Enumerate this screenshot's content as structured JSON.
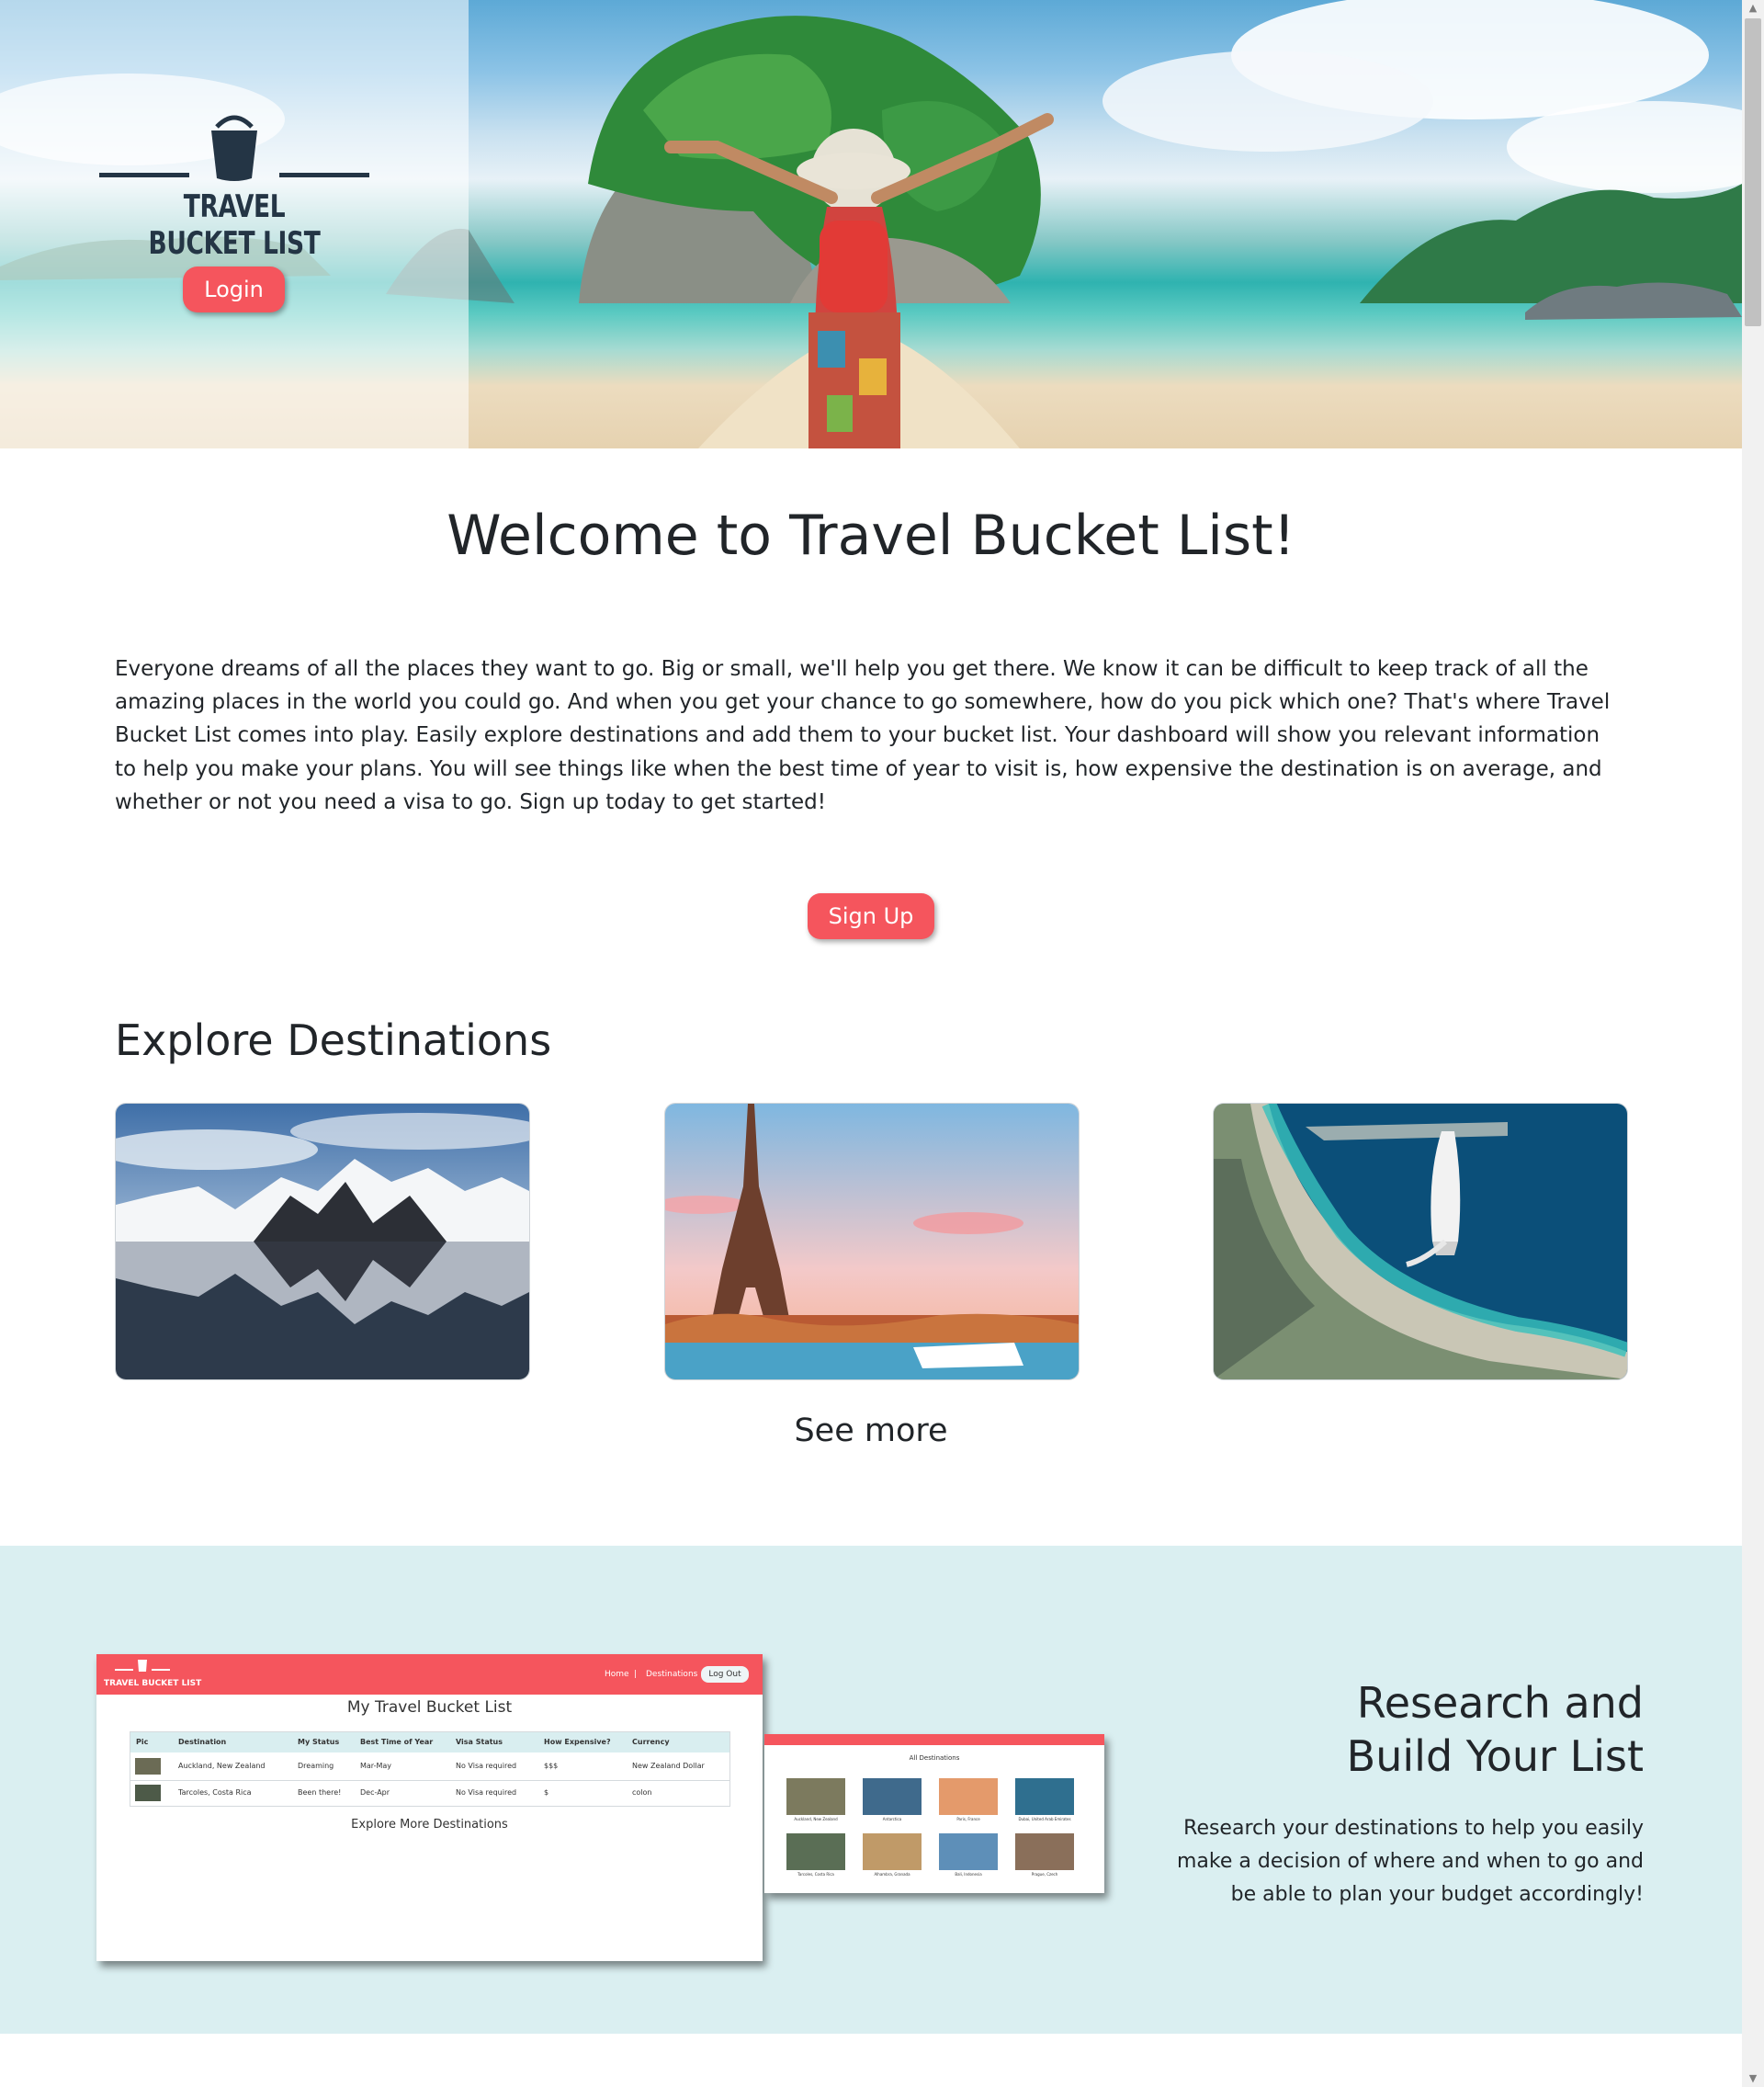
{
  "brand": {
    "logo_text": "TRAVEL BUCKET LIST"
  },
  "header": {
    "login_label": "Login"
  },
  "welcome": {
    "title": "Welcome to Travel Bucket List!",
    "intro": "Everyone dreams of all the places they want to go. Big or small, we'll help you get there. We know it can be difficult to keep track of all the amazing places in the world you could go. And when you get your chance to go somewhere, how do you pick which one? That's where Travel Bucket List comes into play. Easily explore destinations and add them to your bucket list. Your dashboard will show you relevant information to help you make your plans. You will see things like when the best time of year to visit is, how expensive the destination is on average, and whether or not you need a visa to go. Sign up today to get started!",
    "signup_label": "Sign Up"
  },
  "explore": {
    "title": "Explore Destinations",
    "cards": [
      {
        "icon": "snowy-mountains-photo"
      },
      {
        "icon": "eiffel-tower-photo"
      },
      {
        "icon": "burj-al-arab-photo"
      }
    ],
    "see_more": "See more"
  },
  "research": {
    "title": "Research and Build Your List",
    "text": "Research your destinations to help you easily make a decision of where and when to go and be able to plan your budget accordingly!",
    "dashboard_preview": {
      "logo_text": "TRAVEL BUCKET LIST",
      "nav_home": "Home",
      "nav_sep": "|",
      "nav_destinations": "Destinations",
      "logout": "Log Out",
      "title": "My Travel Bucket List",
      "columns": [
        "Pic",
        "Destination",
        "My Status",
        "Best Time of Year",
        "Visa Status",
        "How Expensive?",
        "Currency"
      ],
      "rows": [
        [
          "",
          "Auckland, New Zealand",
          "Dreaming",
          "Mar-May",
          "No Visa required",
          "$$$",
          "New Zealand Dollar"
        ],
        [
          "",
          "Tarcoles, Costa Rica",
          "Been there!",
          "Dec-Apr",
          "No Visa required",
          "$",
          "colon"
        ]
      ],
      "explore_more": "Explore More Destinations"
    },
    "destinations_preview": {
      "title": "All Destinations",
      "captions": [
        "Auckland, New Zealand",
        "Antarctica",
        "Paris, France",
        "Dubai, United Arab Emirates",
        "Tarcoles, Costa Rica",
        "Alhambra, Granada",
        "Bali, Indonesia",
        "Prague, Czech"
      ]
    }
  },
  "colors": {
    "accent": "#f5555d",
    "research_bg": "#daeff1",
    "text": "#212529"
  }
}
